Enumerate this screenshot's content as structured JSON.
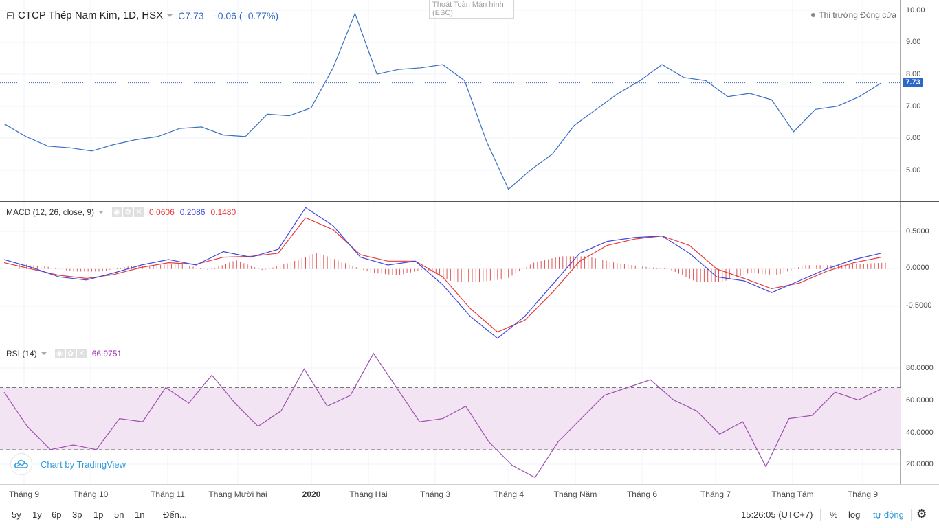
{
  "header": {
    "title": "CTCP Thép Nam Kim, 1D, HSX",
    "close_label": "C",
    "close_value": "7.73",
    "change": "−0.06 (−0.77%)",
    "exit_fullscreen": "Thoát Toàn Màn hình",
    "exit_fullscreen_key": "(ESC)",
    "market_status": "Thị trường Đóng cửa",
    "last_price_badge": "7.73"
  },
  "macd": {
    "label": "MACD (12, 26, close, 9)",
    "v1": "0.0606",
    "v2": "0.2086",
    "v3": "0.1480"
  },
  "rsi": {
    "label": "RSI (14)",
    "value": "66.9751"
  },
  "price_axis": [
    "10.00",
    "9.00",
    "8.00",
    "7.00",
    "6.00",
    "5.00"
  ],
  "macd_axis": [
    "0.5000",
    "0.0000",
    "-0.5000"
  ],
  "rsi_axis": [
    "80.0000",
    "60.0000",
    "40.0000",
    "20.0000"
  ],
  "time_axis": [
    "Tháng 9",
    "Tháng 10",
    "Tháng 11",
    "Tháng Mười hai",
    "2020",
    "Tháng Hai",
    "Tháng 3",
    "Tháng 4",
    "Tháng Năm",
    "Tháng 6",
    "Tháng 7",
    "Tháng Tám",
    "Tháng 9"
  ],
  "logo": {
    "text": "Chart by TradingView"
  },
  "toolbar": {
    "ranges": [
      "5y",
      "1y",
      "6p",
      "3p",
      "1p",
      "5n",
      "1n"
    ],
    "goto": "Đến...",
    "time": "15:26:05 (UTC+7)",
    "percent": "%",
    "log": "log",
    "auto": "tự động"
  },
  "colors": {
    "price": "#3a6fc2",
    "macd": "#3f47e0",
    "signal": "#e83a3a",
    "histogram": "#e05252",
    "rsi": "#9c4fb0",
    "rsi_band": "#f3e4f3"
  },
  "chart_data": [
    {
      "type": "line",
      "title": "CTCP Thép Nam Kim, 1D, HSX",
      "ylim": [
        4.2,
        10.0
      ],
      "x": [
        "Tháng 9",
        "Tháng 10",
        "Tháng 11",
        "Tháng Mười hai",
        "2020",
        "Tháng Hai",
        "Tháng 3",
        "Tháng 4",
        "Tháng Năm",
        "Tháng 6",
        "Tháng 7",
        "Tháng Tám",
        "Tháng 9"
      ],
      "series": [
        {
          "values": [
            6.45,
            6.05,
            5.75,
            5.7,
            5.6,
            5.8,
            5.95,
            6.05,
            6.3,
            6.35,
            6.1,
            6.05,
            6.75,
            6.7,
            6.95,
            8.2,
            9.9,
            8.0,
            8.15,
            8.2,
            8.3,
            7.8,
            5.9,
            4.4,
            5.0,
            5.5,
            6.4,
            6.9,
            7.4,
            7.8,
            8.3,
            7.9,
            7.8,
            7.3,
            7.4,
            7.2,
            6.2,
            6.9,
            7.0,
            7.3,
            7.73
          ]
        }
      ]
    },
    {
      "type": "line",
      "title": "MACD (12, 26, close, 9)",
      "ylim": [
        -0.9,
        0.8
      ],
      "series": [
        {
          "values": [
            0.12,
            0.02,
            -0.1,
            -0.14,
            -0.05,
            0.05,
            0.12,
            0.05,
            0.22,
            0.15,
            0.25,
            0.78,
            0.55,
            0.15,
            0.05,
            0.1,
            -0.2,
            -0.6,
            -0.88,
            -0.6,
            -0.2,
            0.2,
            0.35,
            0.4,
            0.42,
            0.2,
            -0.1,
            -0.15,
            -0.3,
            -0.15,
            0.0,
            0.12,
            0.2
          ]
        },
        {
          "values": [
            0.08,
            0.0,
            -0.08,
            -0.12,
            -0.07,
            0.02,
            0.08,
            0.06,
            0.15,
            0.16,
            0.2,
            0.65,
            0.5,
            0.18,
            0.1,
            0.1,
            -0.1,
            -0.5,
            -0.8,
            -0.65,
            -0.3,
            0.1,
            0.3,
            0.38,
            0.42,
            0.3,
            0.0,
            -0.12,
            -0.25,
            -0.18,
            -0.03,
            0.08,
            0.15
          ]
        }
      ]
    },
    {
      "type": "line",
      "title": "RSI (14)",
      "ylim": [
        10,
        95
      ],
      "series": [
        {
          "values": [
            67,
            45,
            30,
            33,
            30,
            50,
            48,
            70,
            60,
            78,
            60,
            45,
            55,
            82,
            58,
            65,
            92,
            70,
            48,
            50,
            58,
            35,
            20,
            12,
            35,
            50,
            65,
            70,
            75,
            62,
            55,
            40,
            48,
            19,
            50,
            52,
            67,
            62,
            69
          ]
        }
      ]
    }
  ]
}
